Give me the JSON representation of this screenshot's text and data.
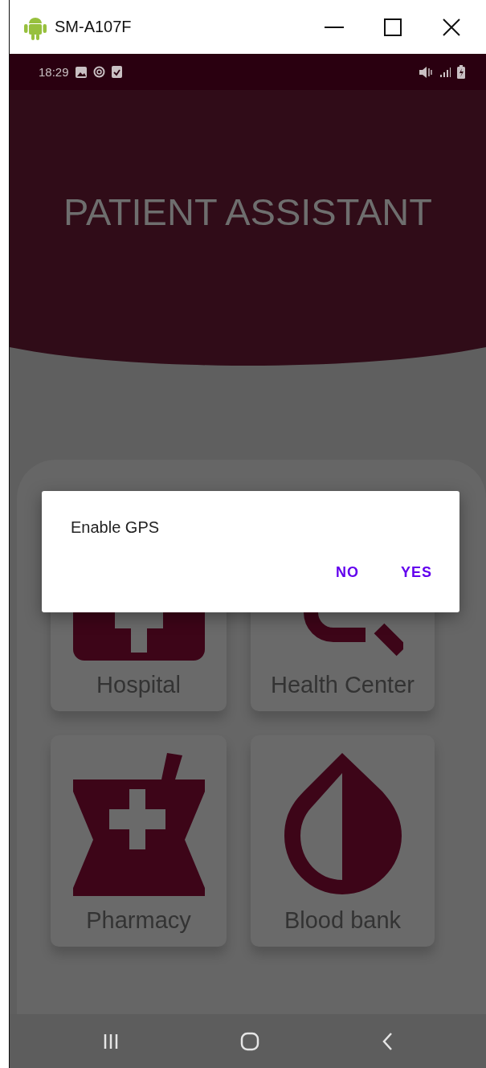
{
  "window": {
    "title": "SM-A107F"
  },
  "status_bar": {
    "time": "18:29"
  },
  "header": {
    "title": "PATIENT ASSISTANT"
  },
  "tiles": [
    {
      "label": "Hospital",
      "kind": "hospital"
    },
    {
      "label": "Health Center",
      "kind": "health"
    },
    {
      "label": "Pharmacy",
      "kind": "pharmacy"
    },
    {
      "label": "Blood bank",
      "kind": "blood"
    }
  ],
  "dialog": {
    "message": "Enable GPS",
    "buttons": [
      "NO",
      "YES"
    ]
  }
}
